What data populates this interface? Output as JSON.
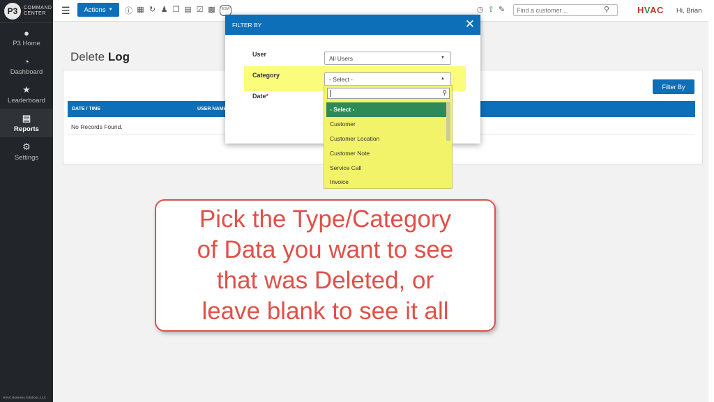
{
  "app": {
    "brand_line1": "COMMAND",
    "brand_line2": "CENTER",
    "footer": "HVAC Business Solutions, LLC",
    "greeting": "Hi, Brian",
    "logo_text_h": "H",
    "logo_text_v": "V",
    "logo_text_ac": "AC"
  },
  "sidebar": {
    "items": [
      {
        "label": "P3 Home",
        "icon": "p3-logo-icon"
      },
      {
        "label": "Dashboard",
        "icon": "gauge-icon"
      },
      {
        "label": "Leaderboard",
        "icon": "trophy-icon"
      },
      {
        "label": "Reports",
        "icon": "report-icon"
      },
      {
        "label": "Settings",
        "icon": "gear-icon"
      }
    ]
  },
  "toolbar": {
    "actions_label": "Actions",
    "search_placeholder": "Find a customer ...",
    "esm_label": "ESM"
  },
  "page": {
    "title_plain": "Delete ",
    "title_bold": "Log",
    "filter_button": "Filter By",
    "columns": [
      "DATE / TIME",
      "USER NAME"
    ],
    "empty_message": "No Records Found."
  },
  "modal": {
    "title": "FILTER BY",
    "user_label": "User",
    "user_value": "All Users",
    "category_label": "Category",
    "category_value": "- Select -",
    "date_label": "Date",
    "date_required": "*",
    "options": [
      "- Select -",
      "Customer",
      "Customer Location",
      "Customer Note",
      "Service Call",
      "Invoice"
    ],
    "selected_option": "- Select -"
  },
  "callout": {
    "lines": [
      "Pick the Type/Category",
      "of Data you want to see",
      "that was Deleted, or",
      "leave blank to see it all"
    ]
  },
  "colors": {
    "primary": "#0d6fb8",
    "sidebar": "#222529",
    "highlight": "#fbfb6e",
    "selected": "#2e8b57",
    "callout_text": "#e05048"
  }
}
